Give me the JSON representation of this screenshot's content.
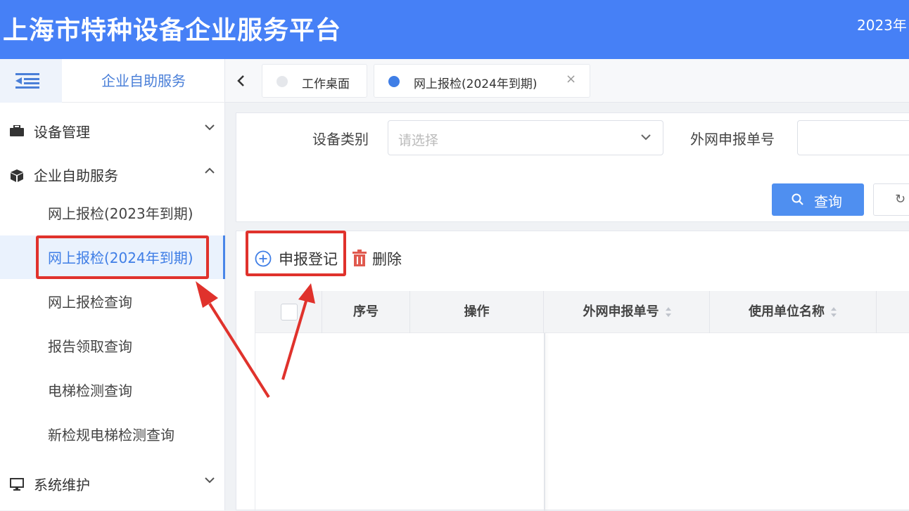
{
  "header": {
    "title": "上海市特种设备企业服务平台",
    "date": "2023年"
  },
  "sidebar": {
    "title": "企业自助服务",
    "groups": [
      {
        "label": "设备管理",
        "icon": "briefcase-icon",
        "expanded": false
      },
      {
        "label": "企业自助服务",
        "icon": "cube-icon",
        "expanded": true
      },
      {
        "label": "系统维护",
        "icon": "monitor-icon",
        "expanded": false
      }
    ],
    "subitems": [
      {
        "label": "网上报检(2023年到期)",
        "active": false
      },
      {
        "label": "网上报检(2024年到期)",
        "active": true
      },
      {
        "label": "网上报检查询",
        "active": false
      },
      {
        "label": "报告领取查询",
        "active": false
      },
      {
        "label": "电梯检测查询",
        "active": false
      },
      {
        "label": "新检规电梯检测查询",
        "active": false
      }
    ]
  },
  "tabs": [
    {
      "label": "工作桌面",
      "active": false,
      "dot_color": "#e5e7eb"
    },
    {
      "label": "网上报检(2024年到期)",
      "active": true,
      "dot_color": "#3f7ee6",
      "close": "×"
    }
  ],
  "filter": {
    "category_label": "设备类别",
    "category_placeholder": "请选择",
    "order_label": "外网申报单号",
    "query_button": "查询",
    "reset_button": "↻"
  },
  "toolbar": {
    "add_label": "申报登记",
    "delete_label": "删除"
  },
  "table": {
    "columns": [
      "序号",
      "操作",
      "外网申报单号",
      "使用单位名称"
    ]
  },
  "colors": {
    "header_bg": "#4680f6",
    "accent": "#4f8ff0",
    "annotation": "#e0322c",
    "delete_icon": "#e05a4f"
  }
}
